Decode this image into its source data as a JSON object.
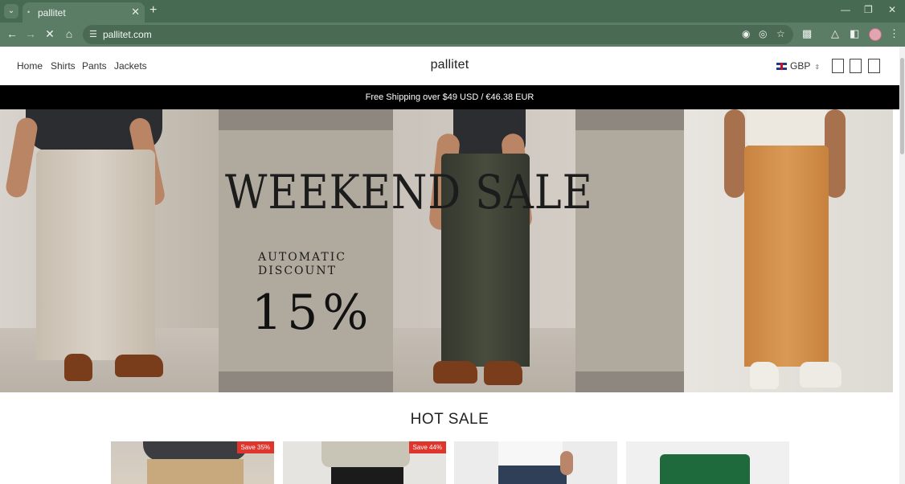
{
  "browser": {
    "tab_title": "pallitet",
    "url": "pallitet.com"
  },
  "header": {
    "nav": [
      "Home",
      "Shirts",
      "Pants",
      "Jackets"
    ],
    "brand": "pallitet",
    "currency": "GBP"
  },
  "announcement": "Free Shipping over $49 USD / €46.38 EUR",
  "hero": {
    "headline": "WEEKEND SALE",
    "subtitle": "AUTOMATIC\nDISCOUNT",
    "discount": "15%"
  },
  "hot_sale": {
    "title": "HOT SALE",
    "products": [
      {
        "badge": "Save 35%",
        "image": "beige-drawstring-pants-photo"
      },
      {
        "badge": "Save 44%",
        "image": "black-pants-photo"
      },
      {
        "badge": "",
        "image": "blue-pants-photo"
      },
      {
        "badge": "",
        "image": "green-shorts-photo"
      }
    ]
  },
  "colors": {
    "browser_frame": "#476a52",
    "announcement_bg": "#000000",
    "badge": "#e0352c"
  }
}
